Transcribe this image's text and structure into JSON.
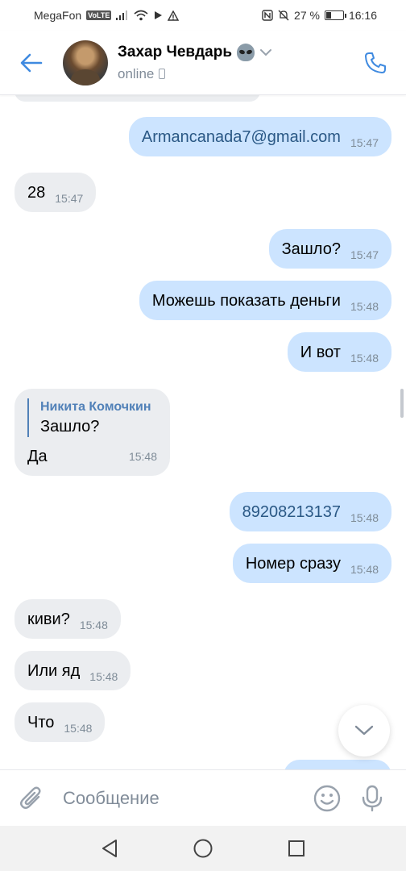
{
  "status_bar": {
    "carrier": "MegaFon",
    "volte": "VoLTE",
    "battery": "27 %",
    "time": "16:16",
    "battery_level": 0.27
  },
  "header": {
    "name": "Захар Чевдарь",
    "status": "online",
    "icons": [
      "back-arrow-icon",
      "alien-emoji-icon",
      "chevron-down-icon",
      "phone-icon"
    ]
  },
  "messages": [
    {
      "dir": "out",
      "text": "Armancanada7@gmail.com",
      "time": "15:47",
      "link": true
    },
    {
      "dir": "in",
      "text": "28",
      "time": "15:47"
    },
    {
      "dir": "out",
      "text": "Зашло?",
      "time": "15:47"
    },
    {
      "dir": "out",
      "text": "Можешь показать деньги",
      "time": "15:48"
    },
    {
      "dir": "out",
      "text": "И вот",
      "time": "15:48"
    },
    {
      "dir": "in",
      "reply": {
        "author": "Никита Комочкин",
        "text": "Зашло?"
      },
      "text": "Да",
      "time": "15:48"
    },
    {
      "dir": "out",
      "text": "89208213137",
      "time": "15:48",
      "link": true
    },
    {
      "dir": "out",
      "text": "Номер сразу",
      "time": "15:48"
    },
    {
      "dir": "in",
      "text": "киви?",
      "time": "15:48"
    },
    {
      "dir": "in",
      "text": "Или яд",
      "time": "15:48"
    },
    {
      "dir": "in",
      "text": "Что",
      "time": "15:48"
    }
  ],
  "input": {
    "placeholder": "Сообщение"
  },
  "colors": {
    "outgoing_bubble": "#cce4ff",
    "incoming_bubble": "#ebedf0",
    "accent": "#5181b8",
    "link": "#2a5885"
  }
}
